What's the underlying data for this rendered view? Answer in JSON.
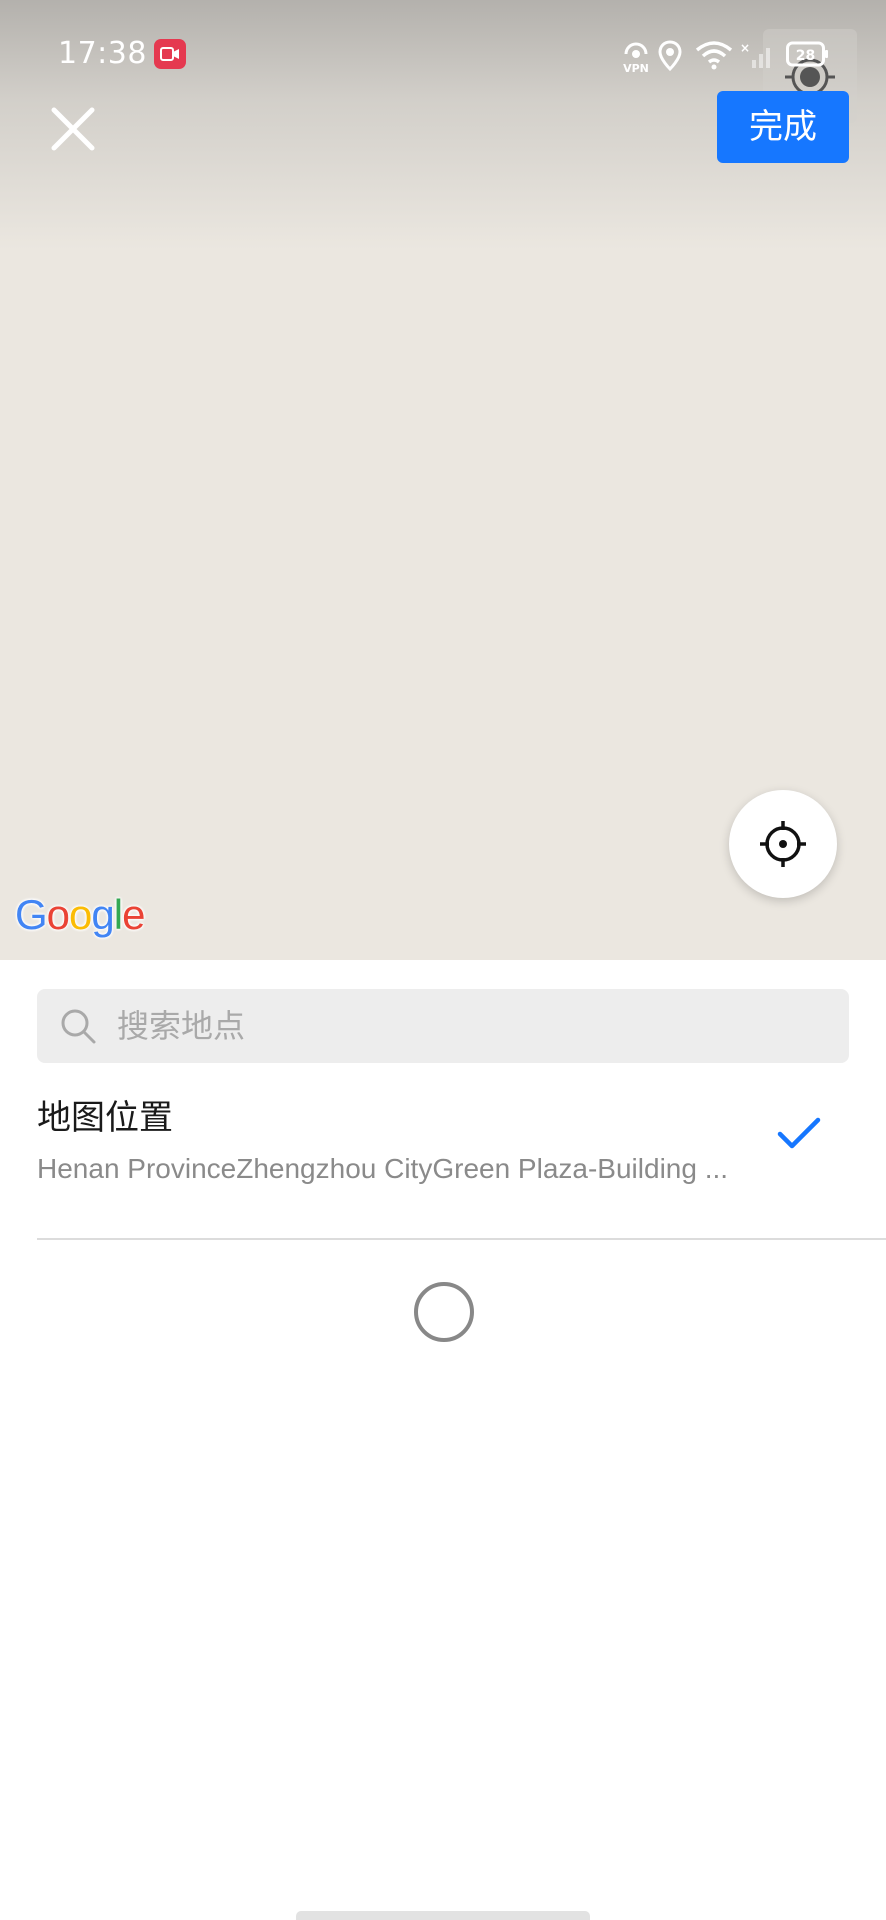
{
  "status_bar": {
    "time": "17:38",
    "icons": [
      "screen-record-icon",
      "vpn-icon",
      "location-pin-icon",
      "wifi-icon",
      "signal-icon",
      "battery-icon"
    ],
    "battery_level": "28"
  },
  "header": {
    "done_label": "完成"
  },
  "map": {
    "provider_logo": "Google",
    "background_color": "#ebe7e0"
  },
  "search": {
    "placeholder": "搜索地点"
  },
  "location_item": {
    "title": "地图位置",
    "address": "Henan ProvinceZhengzhou CityGreen Plaza-Building ...",
    "selected": true
  },
  "colors": {
    "accent": "#1677ff",
    "record_badge": "#e53950",
    "check": "#1677ff"
  }
}
